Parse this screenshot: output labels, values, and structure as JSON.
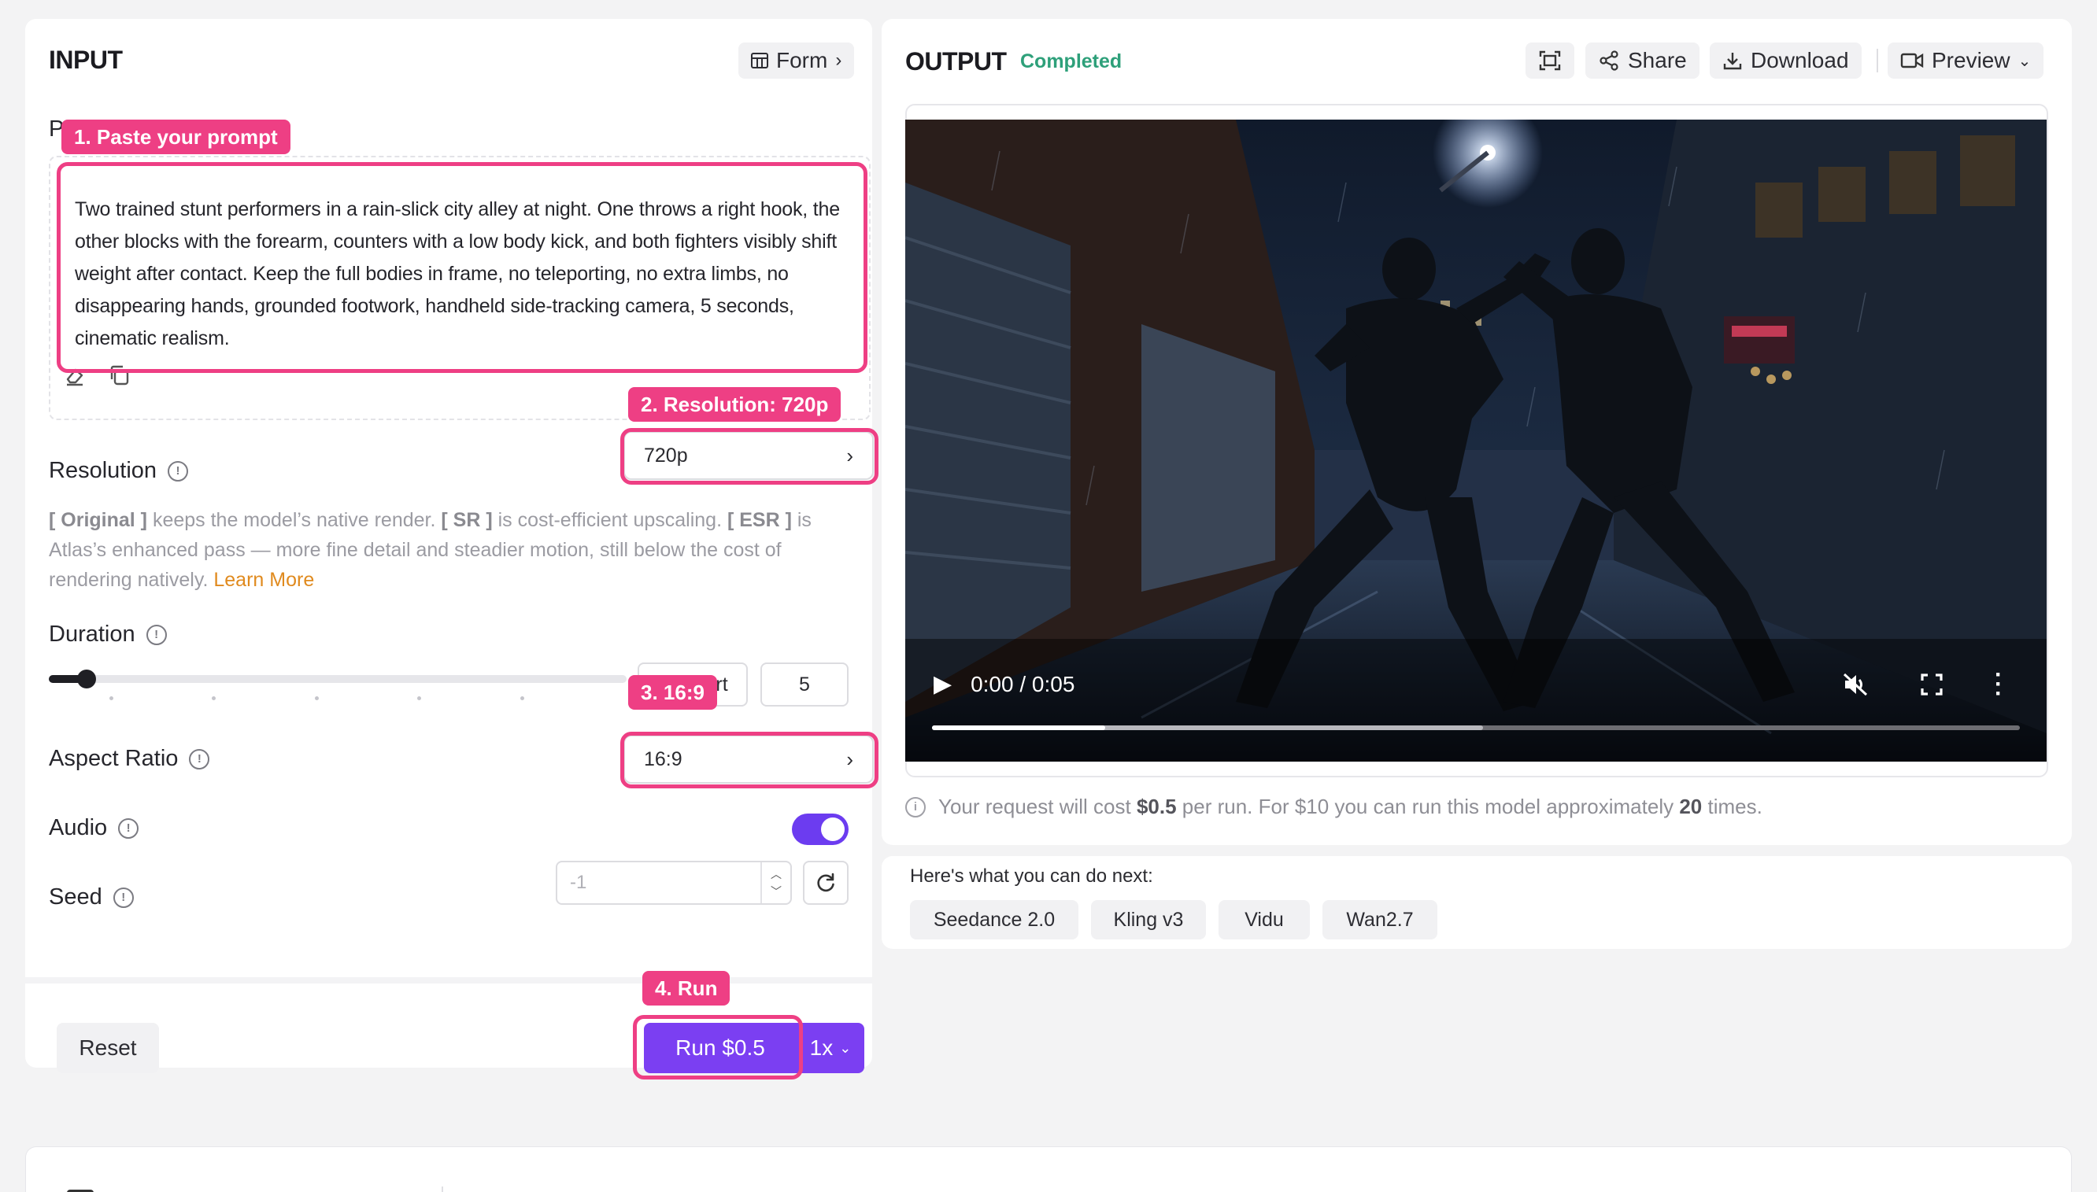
{
  "input": {
    "title": "INPUT",
    "form_button": "Form",
    "prompt_label_stub": "P",
    "prompt_text": "Two trained stunt performers in a rain-slick city alley at night. One throws a right hook, the other blocks with the forearm, counters with a low body kick, and both fighters visibly shift weight after contact. Keep the full bodies in frame, no teleporting, no extra limbs, no disappearing hands, grounded footwork, handheld side-tracking camera, 5 seconds, cinematic realism.",
    "resolution_label": "Resolution",
    "resolution_value": "720p",
    "resolution_desc": {
      "original_tag": "[ Original ]",
      "part1": " keeps the model’s native render. ",
      "sr_tag": "[ SR ]",
      "part2": " is cost-efficient upscaling. ",
      "esr_tag": "[ ESR ]",
      "part3": " is Atlas’s enhanced pass — more fine detail and steadier motion, still below the cost of rendering natively. ",
      "learn_more": "Learn More"
    },
    "duration_label": "Duration",
    "duration_value": "5",
    "duration_slider_fraction": 0.065,
    "smart_label": "Smart",
    "aspect_label": "Aspect Ratio",
    "aspect_value": "16:9",
    "audio_label": "Audio",
    "audio_on": true,
    "seed_label": "Seed",
    "seed_placeholder": "-1",
    "reset_button": "Reset",
    "run_button": "Run $0.5",
    "multiplier": "1x"
  },
  "annotations": {
    "a1": "1. Paste your prompt",
    "a2": "2. Resolution: 720p",
    "a3": "3. 16:9",
    "a4": "4. Run"
  },
  "output": {
    "title": "OUTPUT",
    "status": "Completed",
    "share_button": "Share",
    "download_button": "Download",
    "preview_button": "Preview",
    "time_display": "0:00 / 0:05",
    "cost_note": {
      "prefix": "Your request will cost ",
      "price": "$0.5",
      "middle": " per run. For $10 you can run this model approximately ",
      "count": "20",
      "suffix": " times."
    }
  },
  "next": {
    "title": "Here's what you can do next:",
    "models": [
      "Seedance 2.0",
      "Kling v3",
      "Vidu",
      "Wan2.7"
    ]
  },
  "colors": {
    "accent": "#7b3ff2",
    "annotation": "#ee3f84",
    "status": "#2ea07a",
    "link": "#e08a1e"
  }
}
